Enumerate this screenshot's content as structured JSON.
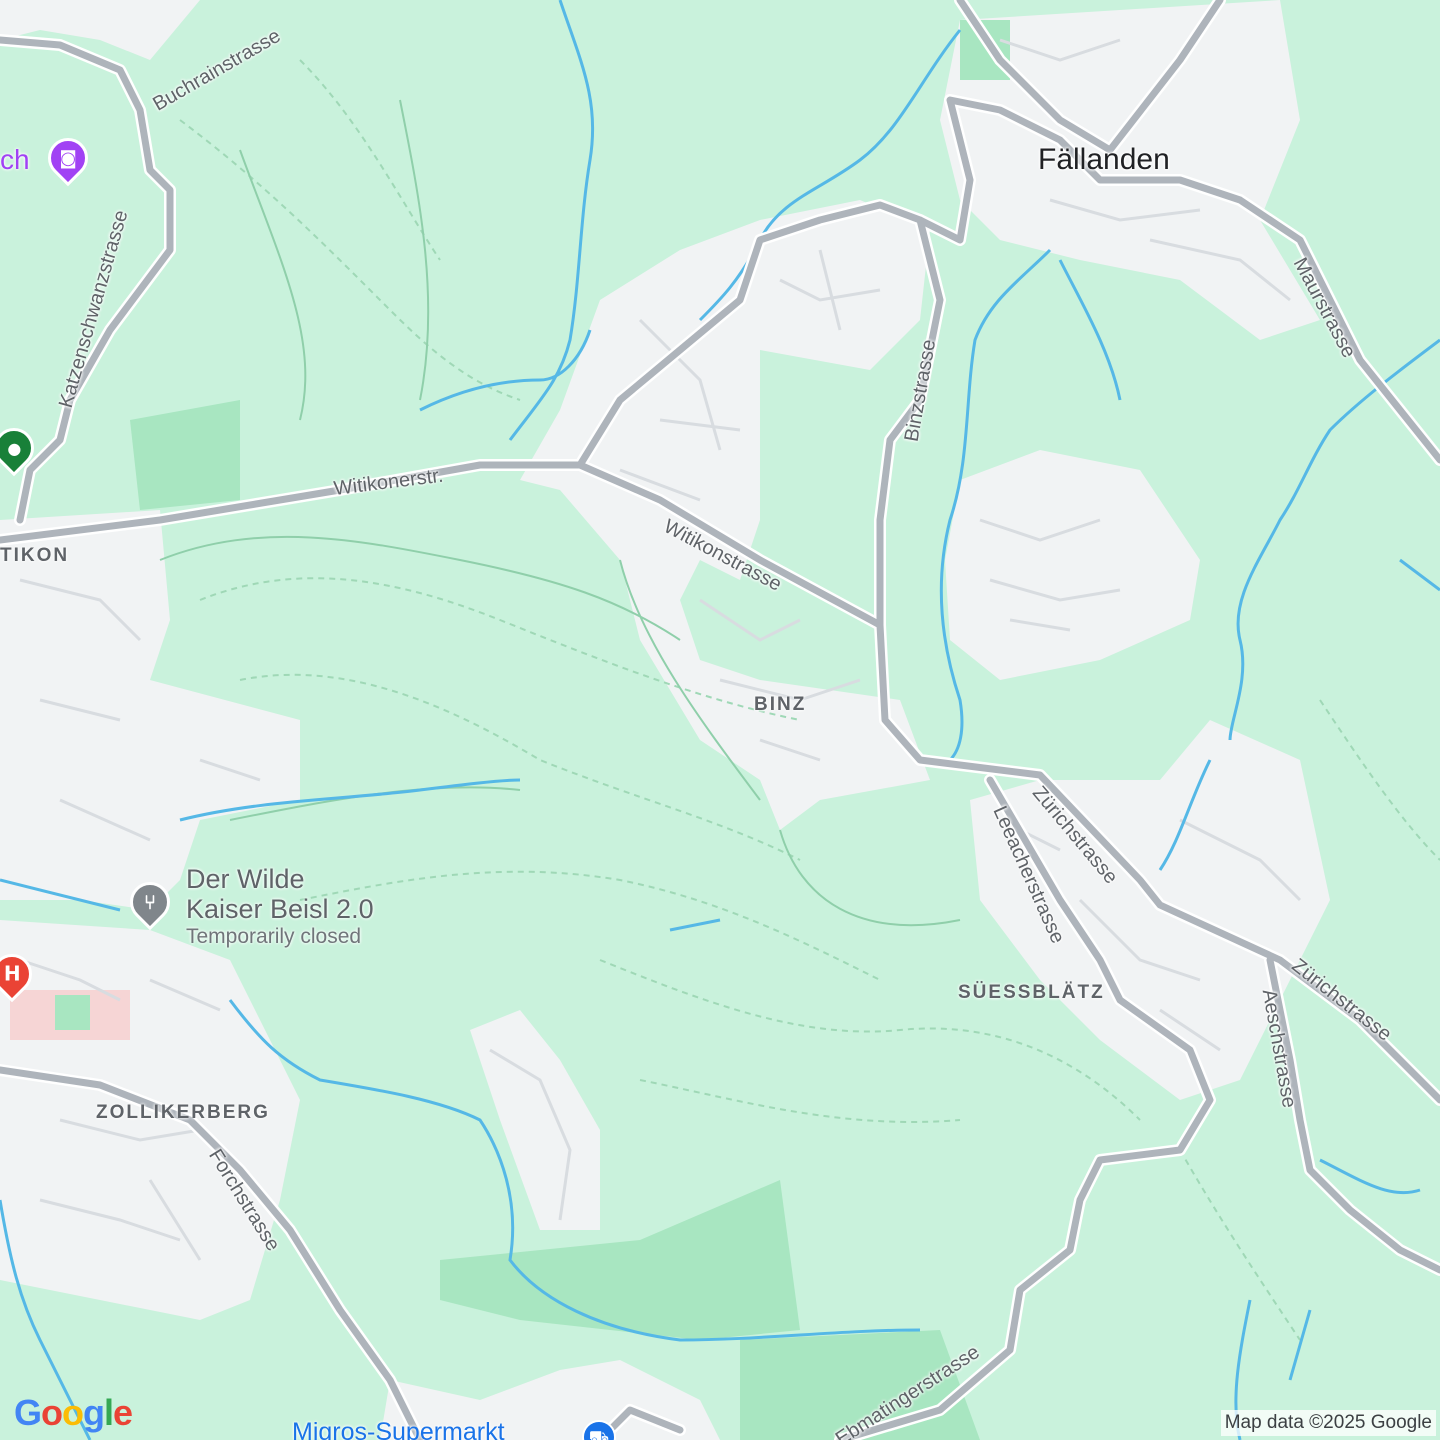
{
  "colors": {
    "forest": "#c9f2dc",
    "urban": "#f1f3f4",
    "road": "#aeb4bb",
    "water": "#55b8e6",
    "park_dark": "#a8e6c1",
    "hospital": "#ea4335",
    "attraction": "#a142f4",
    "restaurant": "#80868b",
    "shopping": "#1a73e8",
    "transit": "#188038"
  },
  "towns": {
    "fallanden": "Fällanden"
  },
  "districts": {
    "witikon": "TIKON",
    "binz": "BINZ",
    "suessblaetz": "SÜESSBLÄTZ",
    "zollikerberg": "ZOLLIKERBERG"
  },
  "streets": {
    "buchrainstrasse": "Buchrainstrasse",
    "katzenschwanzstrasse": "Katzenschwanzstrasse",
    "witikonerstr": "Witikonerstr.",
    "witikonstrasse": "Witikonstrasse",
    "binzstrasse": "Binzstrasse",
    "maurstrasse": "Maurstrasse",
    "zurichstrasse_1": "Zürichstrasse",
    "zurichstrasse_2": "Zürichstrasse",
    "leeacherstrasse": "Leeacherstrasse",
    "aeschstrasse": "Aeschstrasse",
    "forchstrasse": "Forchstrasse",
    "ebmatingerstrasse": "Ebmatingerstrasse"
  },
  "pois": {
    "attraction_partial": "ch",
    "restaurant": {
      "name_line1": "Der Wilde",
      "name_line2": "Kaiser Beisl 2.0",
      "status": "Temporarily closed",
      "icon": "fork-knife-icon"
    },
    "supermarket": {
      "name": "Migros-Supermarkt",
      "icon": "shopping-cart-icon"
    },
    "hospital": {
      "glyph": "H",
      "icon": "hospital-icon"
    }
  },
  "branding": {
    "logo": "Google",
    "attribution": "Map data ©2025 Google"
  }
}
